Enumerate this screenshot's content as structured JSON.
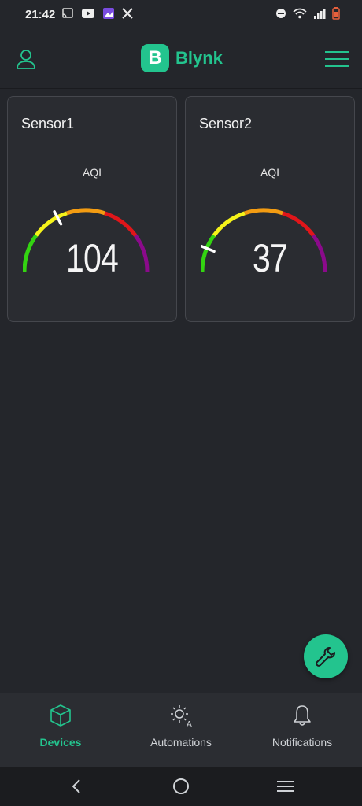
{
  "status_bar": {
    "time": "21:42",
    "left_icons": [
      "cast-icon",
      "youtube-icon",
      "gallery-icon",
      "x-icon"
    ],
    "right_icons": [
      "dnd-icon",
      "wifi-icon",
      "signal-icon",
      "battery-low-icon"
    ]
  },
  "header": {
    "logo_letter": "B",
    "logo_text": "Blynk",
    "accent_color": "#23c48e"
  },
  "devices": [
    {
      "name": "Sensor1",
      "gauge_label": "AQI",
      "value": "104",
      "value_num": 104,
      "max": 300
    },
    {
      "name": "Sensor2",
      "gauge_label": "AQI",
      "value": "37",
      "value_num": 37,
      "max": 300
    }
  ],
  "gauge_colors": [
    "#33d411",
    "#f5f31a",
    "#f39c12",
    "#e0161a",
    "#8b0a8b"
  ],
  "bottom_nav": {
    "items": [
      {
        "label": "Devices",
        "icon": "cube-icon",
        "active": true
      },
      {
        "label": "Automations",
        "icon": "sun-automation-icon",
        "active": false
      },
      {
        "label": "Notifications",
        "icon": "bell-icon",
        "active": false
      }
    ]
  },
  "system_nav": [
    "back-icon",
    "home-icon",
    "recents-icon"
  ]
}
